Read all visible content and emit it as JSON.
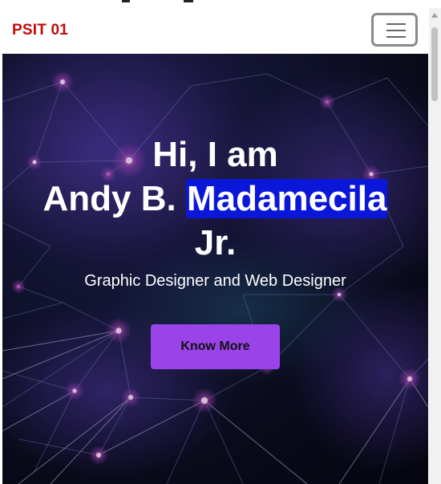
{
  "navbar": {
    "brand": "PSIT 01",
    "menu_icon": "hamburger-menu-icon"
  },
  "hero": {
    "title_line1": "Hi, I am",
    "title_line2_prefix": "Andy B. ",
    "title_line2_highlight": "Madamecila",
    "title_line3": "Jr.",
    "subtitle": "Graphic Designer and Web Designer",
    "cta_label": "Know More",
    "background_image": "network-lines-background"
  },
  "colors": {
    "brand": "#c40a0a",
    "cta": "#9a43e8",
    "highlight": "#0b17d8"
  }
}
